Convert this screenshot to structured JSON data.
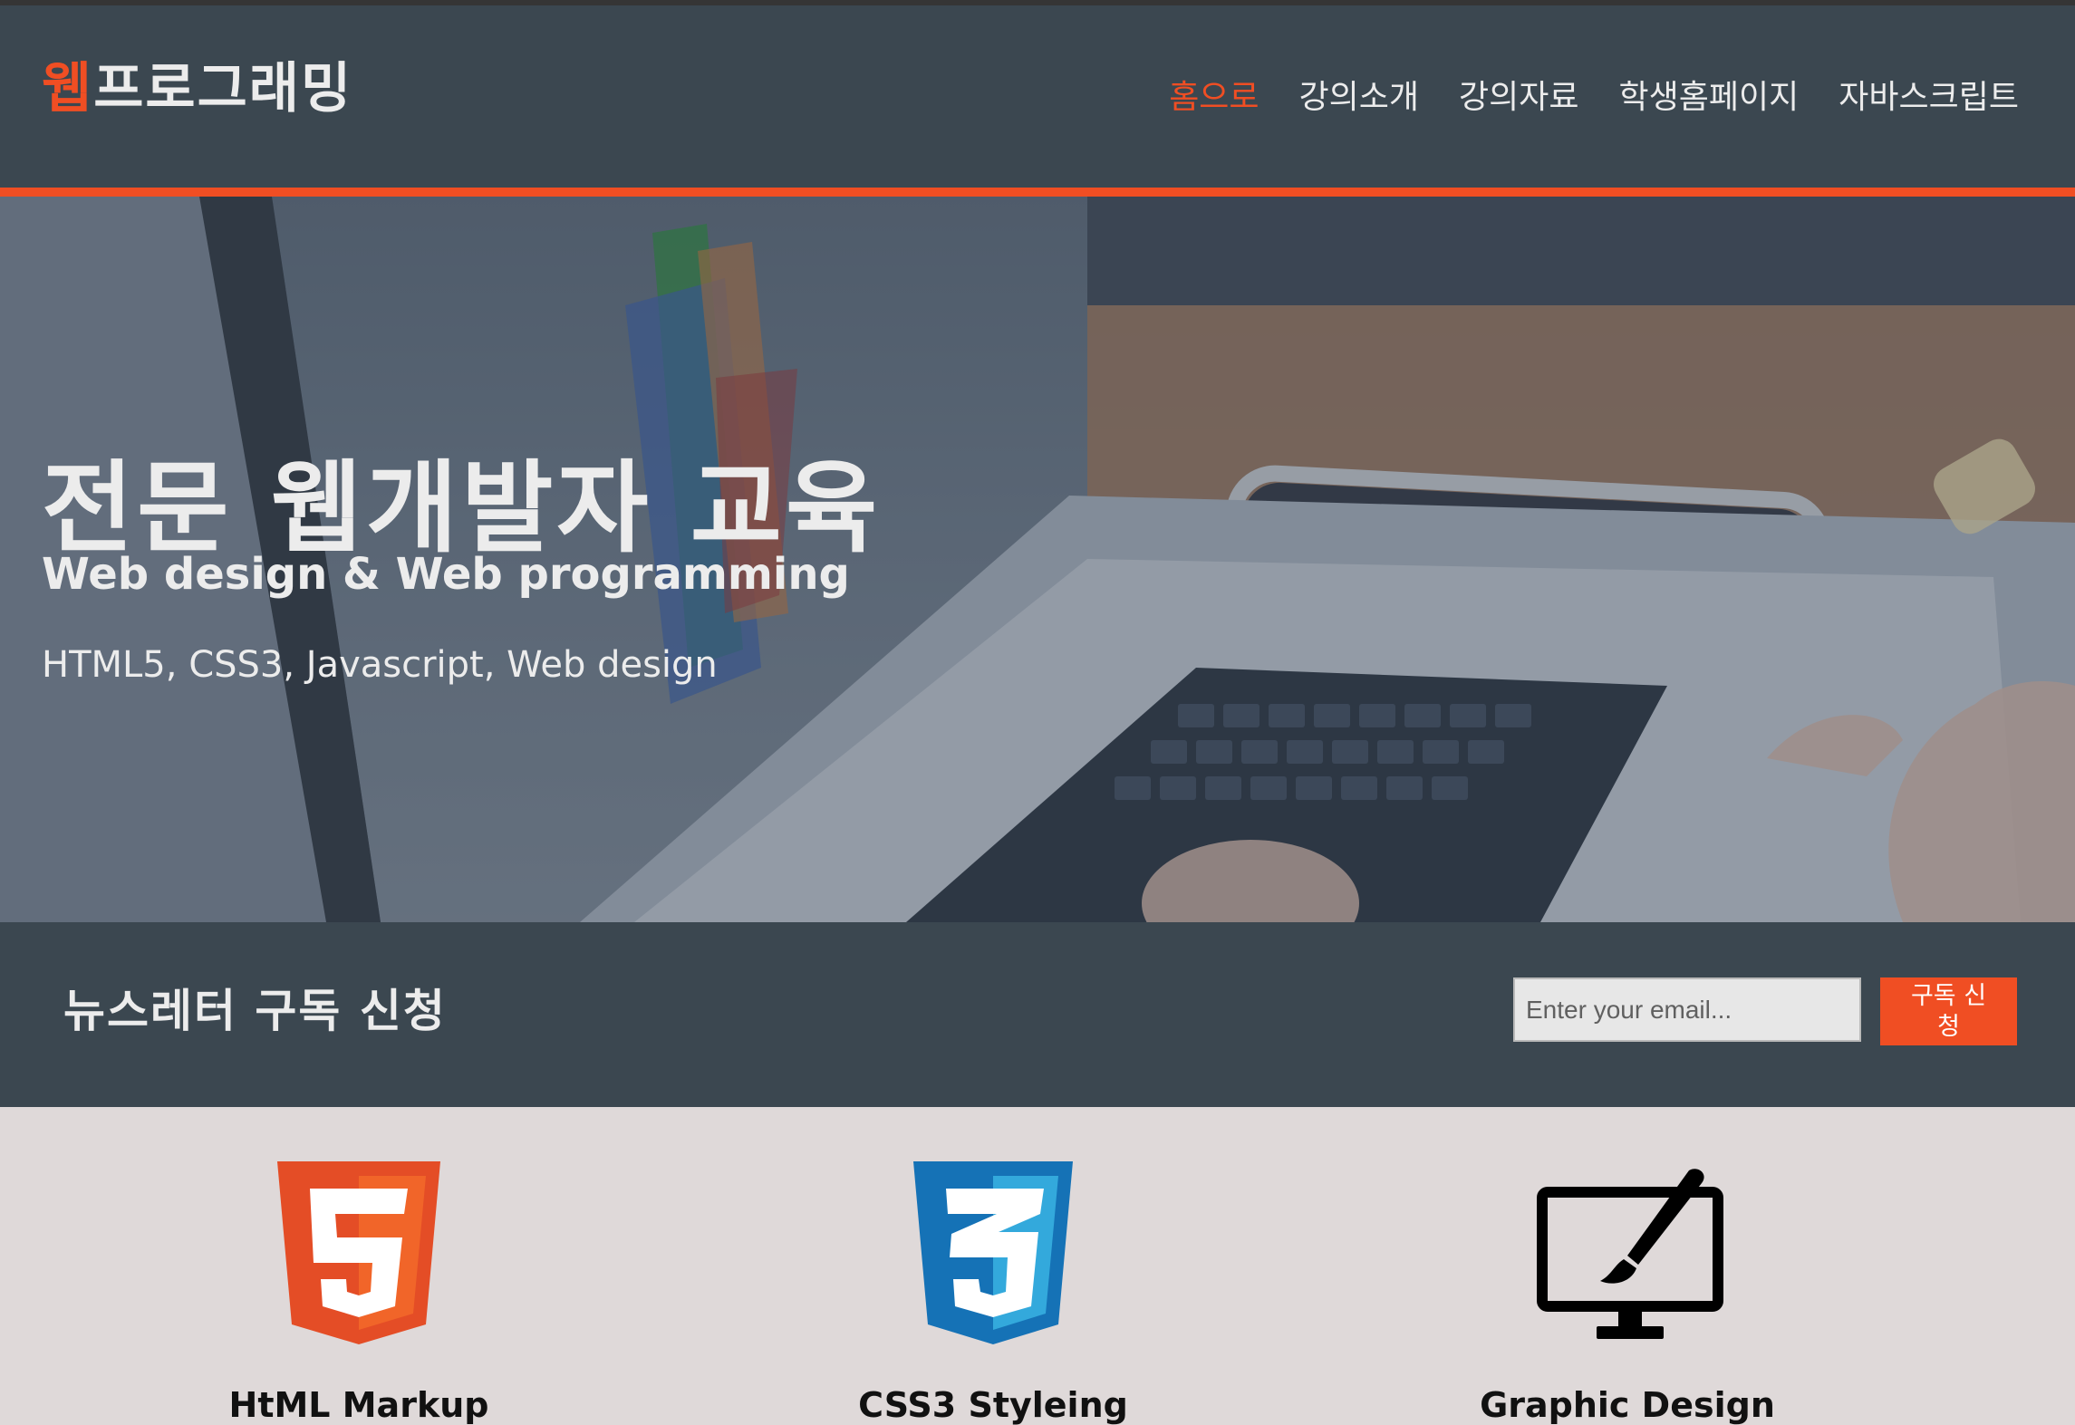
{
  "header": {
    "logo_accent": "웹",
    "logo_rest": "프로그래밍",
    "nav": [
      {
        "label": "홈으로",
        "active": true
      },
      {
        "label": "강의소개",
        "active": false
      },
      {
        "label": "강의자료",
        "active": false
      },
      {
        "label": "학생홈페이지",
        "active": false
      },
      {
        "label": "자바스크립트",
        "active": false
      }
    ]
  },
  "hero": {
    "title": "전문 웹개발자 교육",
    "subtitle": "Web design & Web programming",
    "tags": "HTML5, CSS3, Javascript, Web design"
  },
  "newsletter": {
    "title": "뉴스레터 구독 신청",
    "email_placeholder": "Enter your email...",
    "subscribe_button": "구독 신청"
  },
  "features": [
    {
      "label": "HtML Markup",
      "icon": "html5-icon"
    },
    {
      "label": "CSS3 Styleing",
      "icon": "css3-icon"
    },
    {
      "label": "Graphic Design",
      "icon": "monitor-brush-icon"
    }
  ],
  "colors": {
    "accent": "#f04e23",
    "header_bg": "#3b4750",
    "content_bg": "#dfd9d9",
    "html5": "#e44d26",
    "css3": "#1572b6"
  }
}
